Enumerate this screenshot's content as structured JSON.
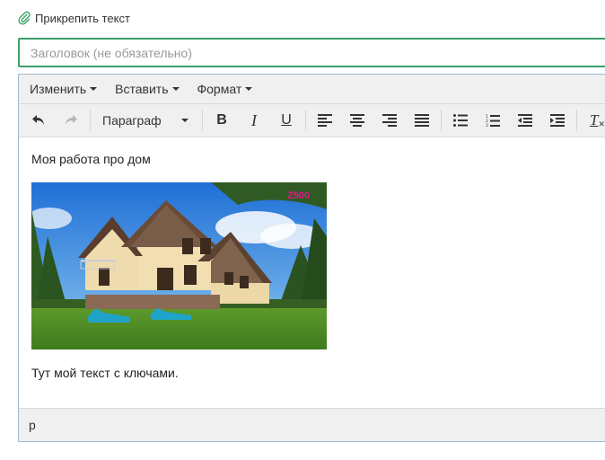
{
  "attach": {
    "label": "Прикрепить текст",
    "icon": "paperclip-icon",
    "icon_color": "#3aa06a"
  },
  "title_field": {
    "placeholder": "Заголовок (не обязательно)",
    "value": "",
    "border_color": "#3aa06a"
  },
  "menubar": {
    "items": [
      {
        "label": "Изменить"
      },
      {
        "label": "Вставить"
      },
      {
        "label": "Формат"
      }
    ]
  },
  "toolbar": {
    "format_select": "Параграф",
    "bold": "B",
    "italic": "I",
    "underline": "U",
    "clear_format": "T",
    "icons": [
      "undo-icon",
      "redo-icon",
      "bold-icon",
      "italic-icon",
      "underline-icon",
      "align-left-icon",
      "align-center-icon",
      "align-right-icon",
      "align-justify-icon",
      "bullet-list-icon",
      "numbered-list-icon",
      "outdent-icon",
      "indent-icon",
      "clear-format-icon"
    ]
  },
  "content": {
    "paragraph1": "Моя работа про дом",
    "image_logo": "Z500",
    "paragraph2": "Тут мой текст с ключами."
  },
  "statusbar": {
    "path": "p"
  }
}
